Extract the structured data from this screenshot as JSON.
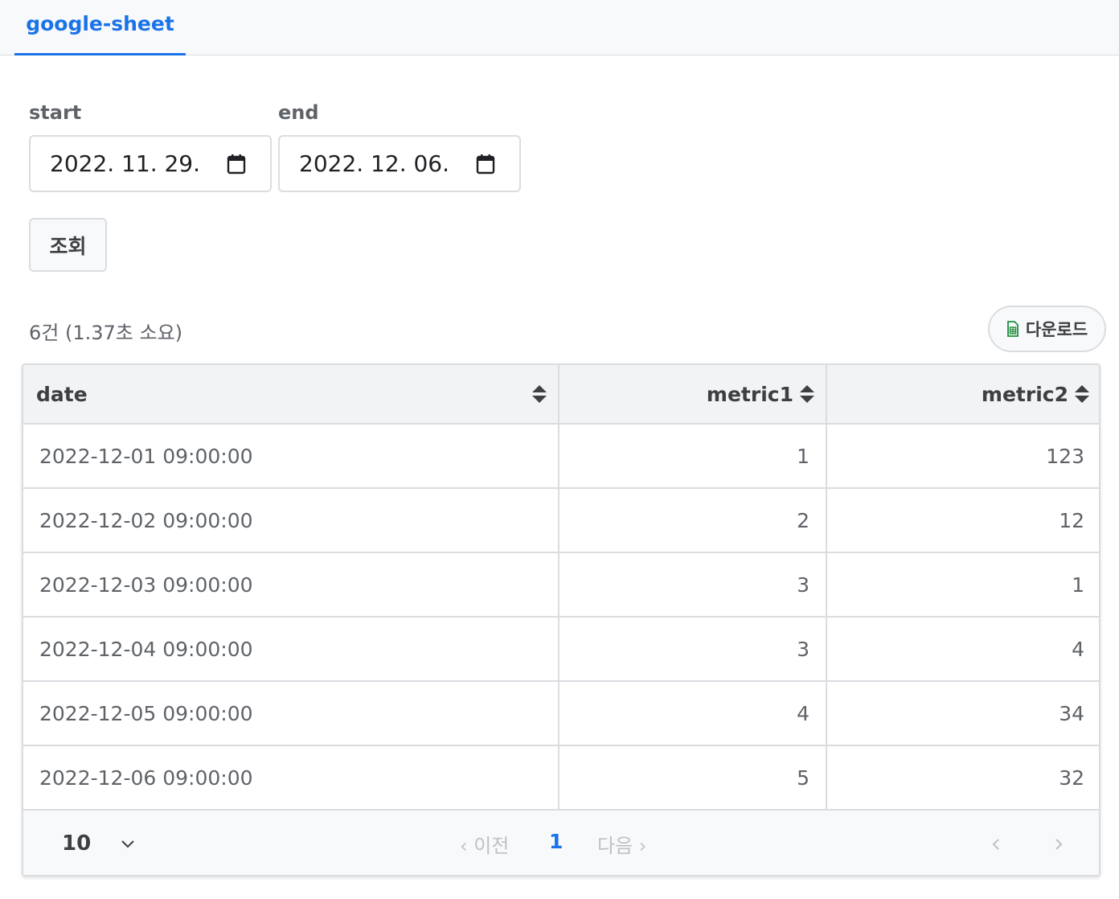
{
  "tab": {
    "label": "google-sheet"
  },
  "filters": {
    "start_label": "start",
    "start_value": "2022. 11. 29.",
    "end_label": "end",
    "end_value": "2022. 12. 06."
  },
  "actions": {
    "query_label": "조회",
    "download_label": "다운로드"
  },
  "summary": "6건 (1.37초 소요)",
  "table": {
    "columns": [
      "date",
      "metric1",
      "metric2"
    ],
    "rows": [
      [
        "2022-12-01 09:00:00",
        "1",
        "123"
      ],
      [
        "2022-12-02 09:00:00",
        "2",
        "12"
      ],
      [
        "2022-12-03 09:00:00",
        "3",
        "1"
      ],
      [
        "2022-12-04 09:00:00",
        "3",
        "4"
      ],
      [
        "2022-12-05 09:00:00",
        "4",
        "34"
      ],
      [
        "2022-12-06 09:00:00",
        "5",
        "32"
      ]
    ]
  },
  "pagination": {
    "page_size": "10",
    "prev_label": "‹ 이전",
    "current_page": "1",
    "next_label": "다음 ›"
  },
  "colors": {
    "accent": "#1a73e8",
    "sheet_icon": "#1e8e3e"
  }
}
